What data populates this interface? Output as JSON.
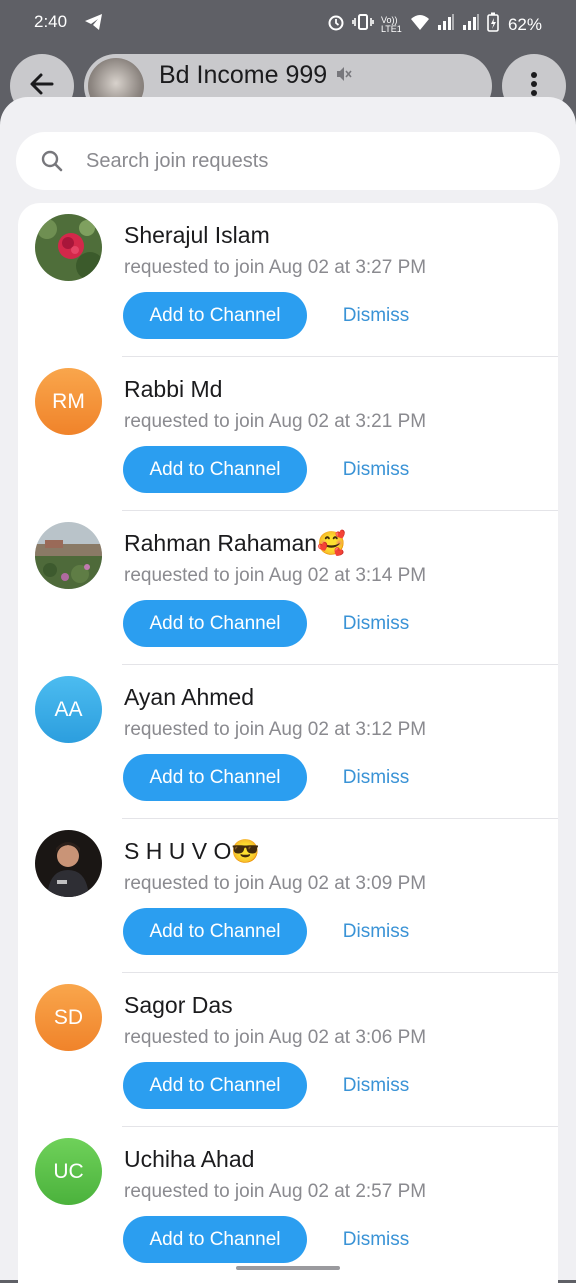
{
  "status_bar": {
    "time": "2:40",
    "network_label": "Vo)) LTE1",
    "battery": "62%"
  },
  "header": {
    "back_icon": "arrow-left-icon",
    "title": "Bd Income 999",
    "subtitle": "",
    "muted_icon": "muted-speaker-icon",
    "menu_icon": "more-vertical-icon"
  },
  "search": {
    "placeholder": "Search join requests",
    "value": ""
  },
  "actions": {
    "add_label": "Add to Channel",
    "dismiss_label": "Dismiss"
  },
  "requests": [
    {
      "name": "Sherajul Islam",
      "request_text": "requested to join Aug 02 at 3:27 PM",
      "initials": "",
      "avatar_type": "photo-flower"
    },
    {
      "name": "Rabbi Md",
      "request_text": "requested to join Aug 02 at 3:21 PM",
      "initials": "RM",
      "avatar_color": "#f5923a"
    },
    {
      "name": "Rahman Rahaman🥰",
      "request_text": "requested to join Aug 02 at 3:14 PM",
      "initials": "",
      "avatar_type": "photo-garden"
    },
    {
      "name": "Ayan Ahmed",
      "request_text": "requested to join Aug 02 at 3:12 PM",
      "initials": "AA",
      "avatar_color": "#3aaee6"
    },
    {
      "name": "S H U V O😎",
      "request_text": "requested to join Aug 02 at 3:09 PM",
      "initials": "",
      "avatar_type": "photo-person"
    },
    {
      "name": "Sagor Das",
      "request_text": "requested to join Aug 02 at 3:06 PM",
      "initials": "SD",
      "avatar_color": "#f5923a"
    },
    {
      "name": "Uchiha Ahad",
      "request_text": "requested to join Aug 02 at 2:57 PM",
      "initials": "UC",
      "avatar_color": "#5cc04a"
    }
  ],
  "colors": {
    "accent": "#2b9ef0",
    "dismiss": "#3a93d6"
  }
}
